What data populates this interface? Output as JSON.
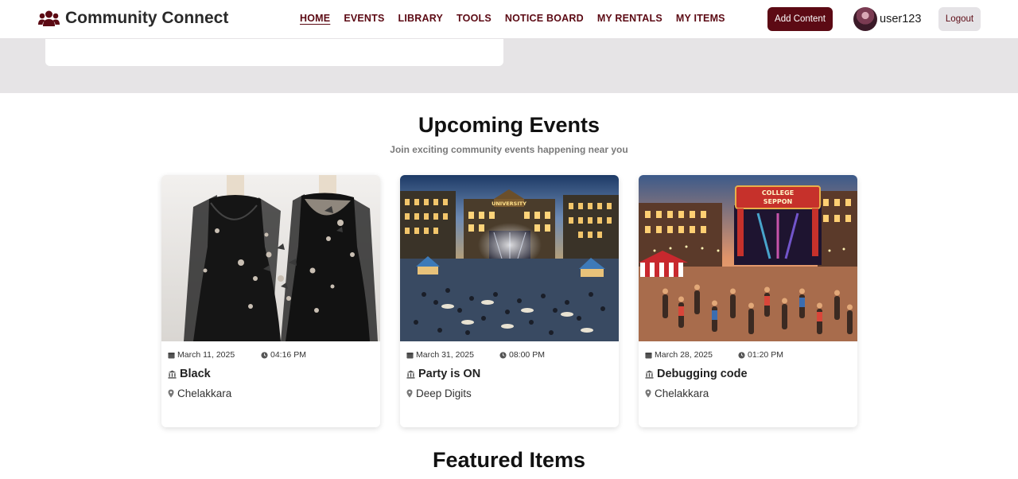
{
  "app": {
    "title": "Community Connect",
    "brand_icon": "users-icon"
  },
  "nav": {
    "items": [
      {
        "label": "HOME",
        "active": true
      },
      {
        "label": "EVENTS",
        "active": false
      },
      {
        "label": "LIBRARY",
        "active": false
      },
      {
        "label": "TOOLS",
        "active": false
      },
      {
        "label": "NOTICE BOARD",
        "active": false
      },
      {
        "label": "MY RENTALS",
        "active": false
      },
      {
        "label": "MY ITEMS",
        "active": false
      }
    ]
  },
  "header": {
    "add_content_label": "Add Content",
    "username": "user123",
    "logout_label": "Logout"
  },
  "colors": {
    "brand": "#5c0a14",
    "band": "#e6e4e6",
    "muted_button": "#e5e3e6"
  },
  "events_section": {
    "title": "Upcoming Events",
    "subtitle": "Join exciting community events happening near you",
    "events": [
      {
        "date": "March 11, 2025",
        "time": "04:16 PM",
        "title": "Black",
        "location": "Chelakkara",
        "image": "black-gowns-butterflies"
      },
      {
        "date": "March 31, 2025",
        "time": "08:00 PM",
        "title": "Party is ON",
        "location": "Deep Digits",
        "image": "university-night-party"
      },
      {
        "date": "March 28, 2025",
        "time": "01:20 PM",
        "title": "Debugging code",
        "location": "Chelakkara",
        "image": "college-festival"
      }
    ]
  },
  "featured_section": {
    "title": "Featured Items"
  },
  "image_texts": {
    "university_sign": "UNIVERSITY",
    "college_banner_line1": "COLLEGE",
    "college_banner_line2": "SEPPON"
  }
}
